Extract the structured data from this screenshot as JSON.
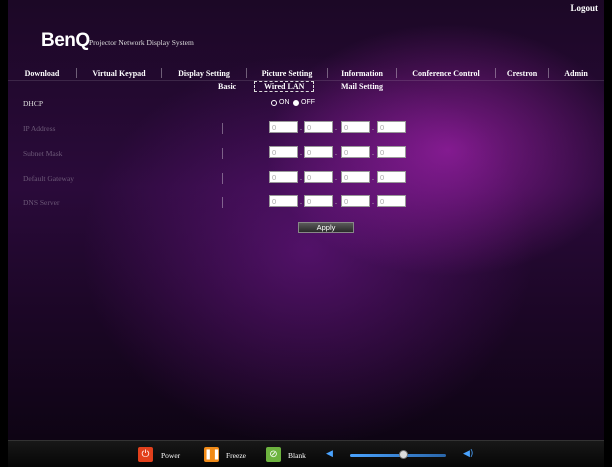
{
  "header": {
    "logout": "Logout",
    "logo": "BenQ",
    "tagline": "Projector Network Display System"
  },
  "menu": {
    "download": "Download",
    "virtual_keypad": "Virtual Keypad",
    "display_setting": "Display Setting",
    "picture_setting": "Picture Setting",
    "information": "Information",
    "conference_control": "Conference Control",
    "crestron": "Crestron",
    "admin": "Admin"
  },
  "subnav": {
    "basic": "Basic",
    "wired_lan": "Wired LAN",
    "mail_setting": "Mail Setting"
  },
  "form": {
    "dhcp": {
      "label": "DHCP",
      "on": "ON",
      "off": "OFF",
      "selected": "OFF"
    },
    "ip_address": {
      "label": "IP Address",
      "octets": [
        "0",
        "0",
        "0",
        "0"
      ]
    },
    "subnet_mask": {
      "label": "Subnet Mask",
      "octets": [
        "0",
        "0",
        "0",
        "0"
      ]
    },
    "default_gateway": {
      "label": "Default Gateway",
      "octets": [
        "0",
        "0",
        "0",
        "0"
      ]
    },
    "dns_server": {
      "label": "DNS Server",
      "octets": [
        "0",
        "0",
        "0",
        "0"
      ]
    },
    "apply": "Apply"
  },
  "bottom": {
    "power": "Power",
    "freeze": "Freeze",
    "blank": "Blank",
    "power_color": "#e2401c",
    "freeze_color": "#f08a17",
    "blank_color": "#6db33f",
    "volume_level": 0.55
  }
}
